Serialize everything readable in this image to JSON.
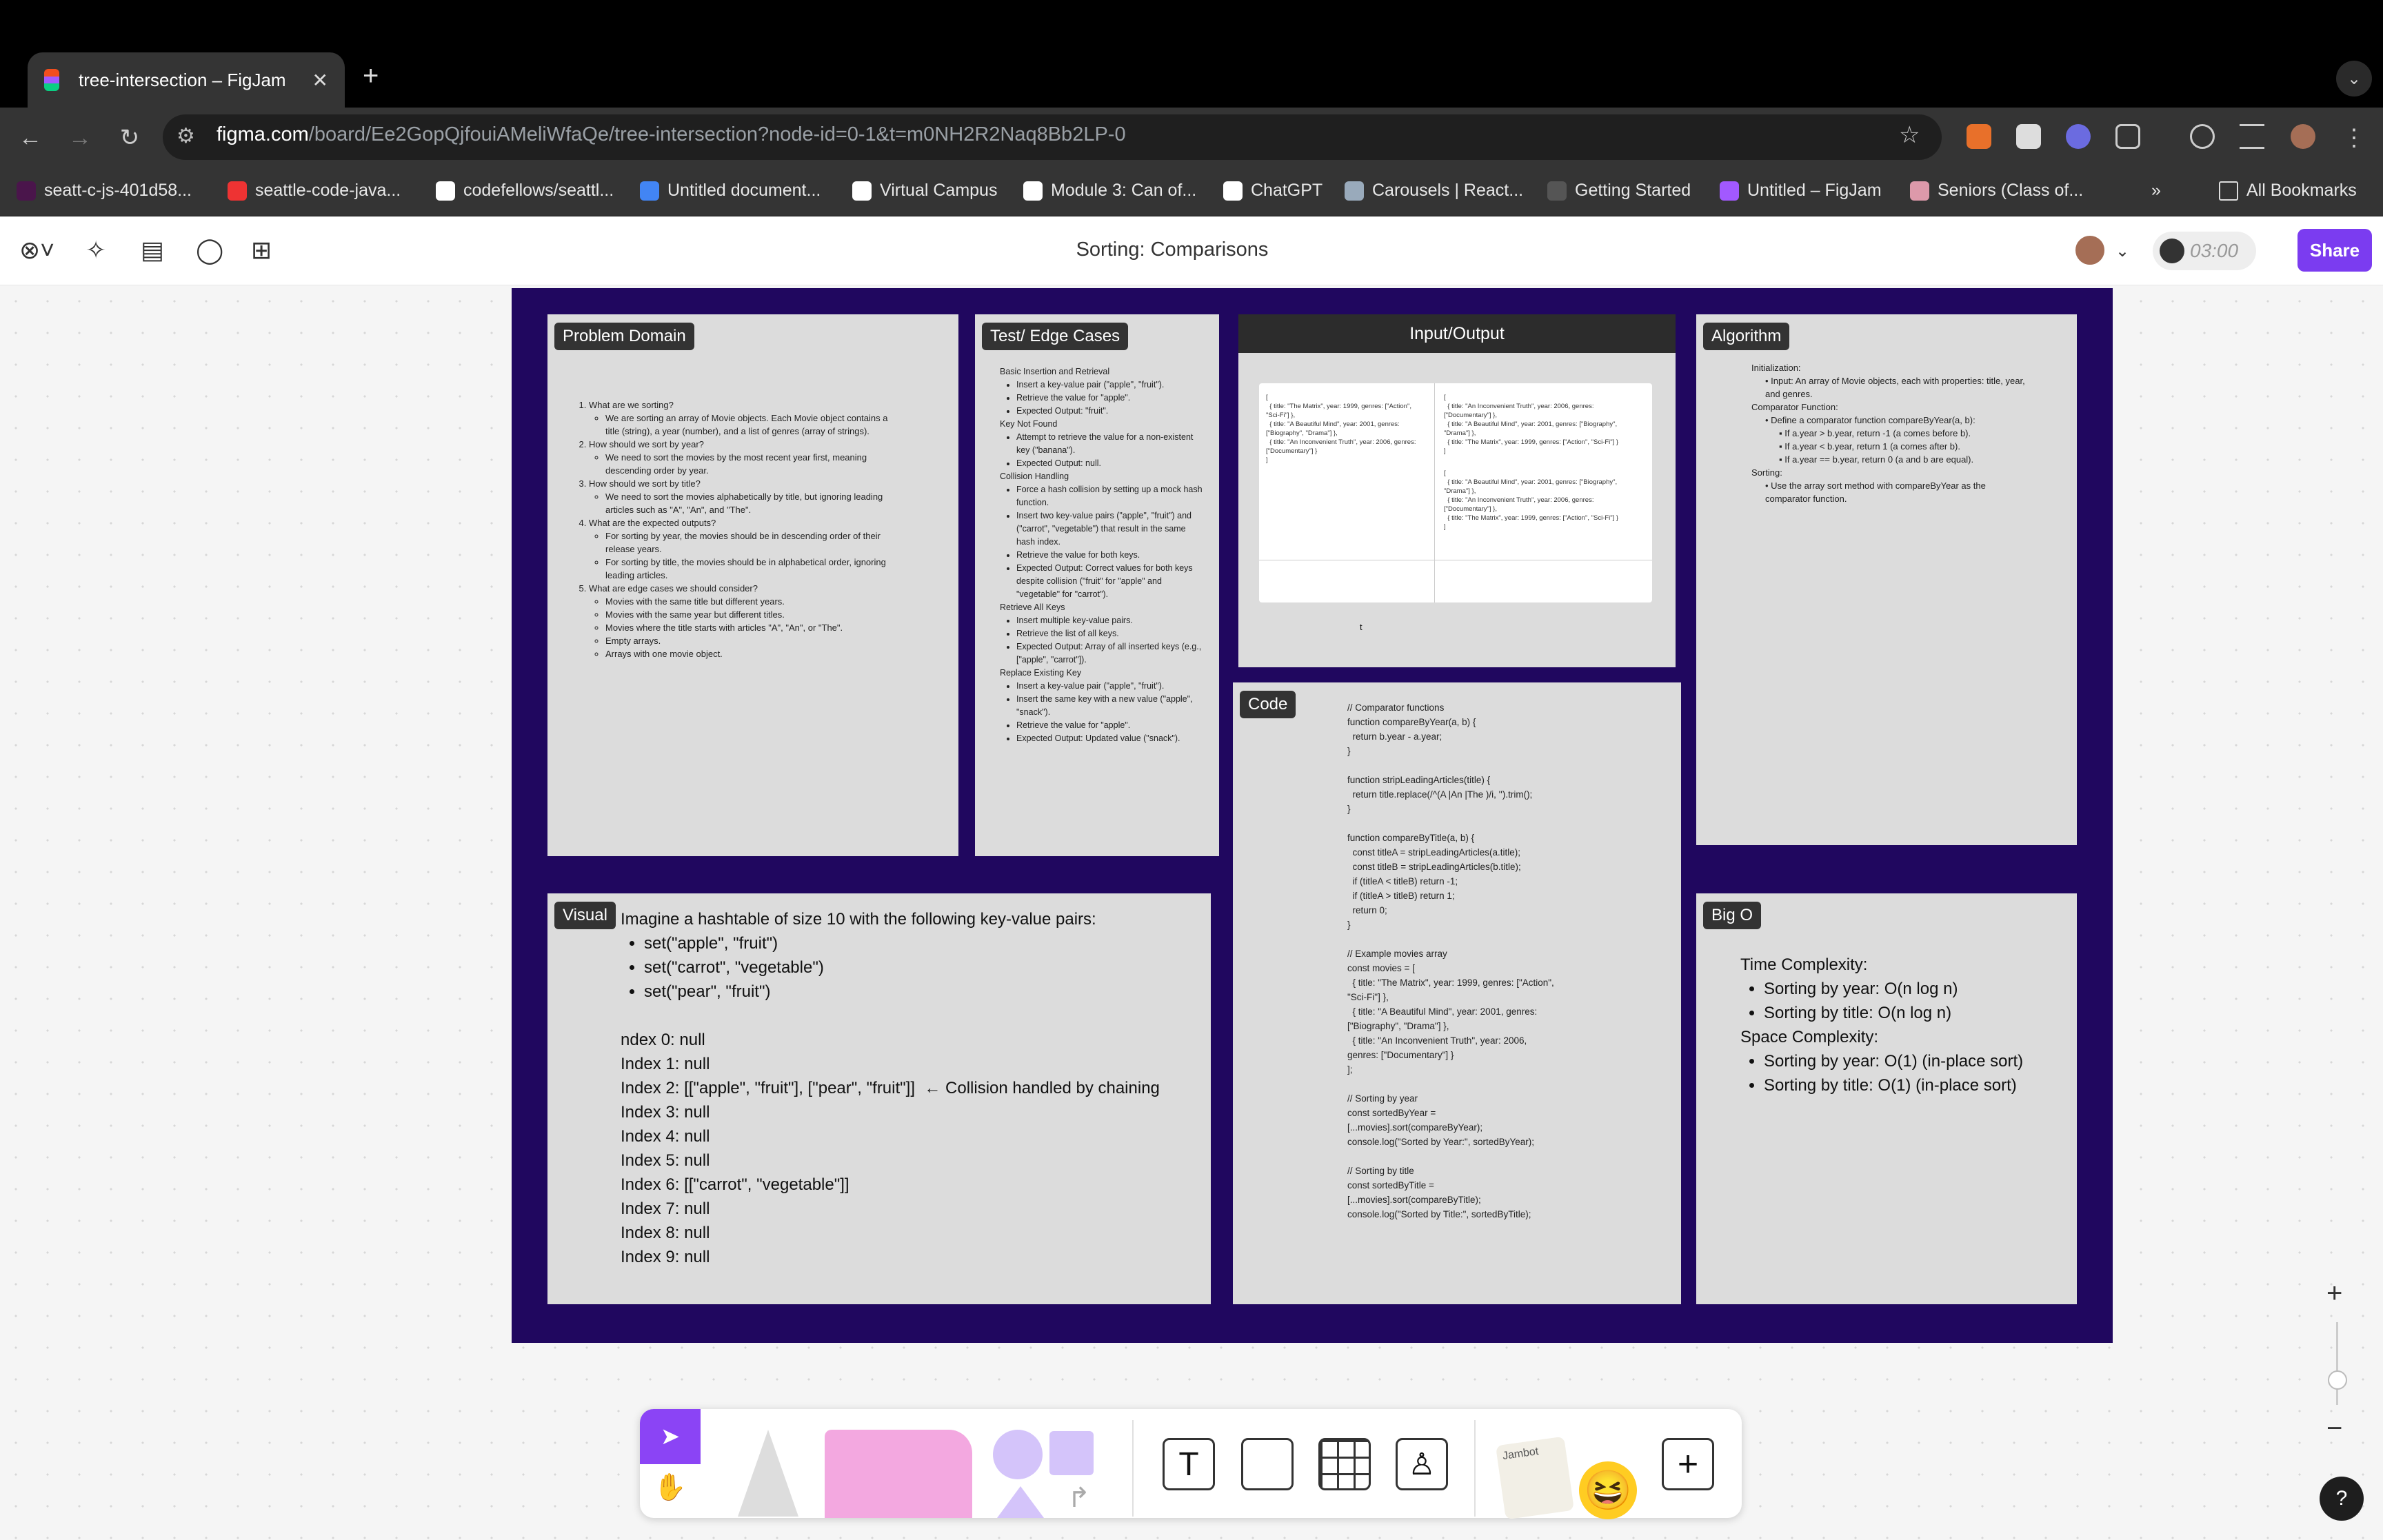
{
  "browser": {
    "tab_title": "tree-intersection – FigJam",
    "tab_close": "✕",
    "new_tab": "+",
    "url_host": "figma.com",
    "url_path": "/board/Ee2GopQjfouiAMeliWfaQe/tree-intersection?node-id=0-1&t=m0NH2R2Naq8Bb2LP-0",
    "bookmarks": [
      {
        "label": "seatt-c-js-401d58...",
        "icon": "slack-icon"
      },
      {
        "label": "seattle-code-java...",
        "icon": "record-icon"
      },
      {
        "label": "codefellows/seattl...",
        "icon": "github-icon"
      },
      {
        "label": "Untitled document...",
        "icon": "docs-icon"
      },
      {
        "label": "Virtual Campus",
        "icon": "globe-icon"
      },
      {
        "label": "Module 3: Can of...",
        "icon": "book-icon"
      },
      {
        "label": "ChatGPT",
        "icon": "chatgpt-icon"
      },
      {
        "label": "Carousels | React...",
        "icon": "react-icon"
      },
      {
        "label": "Getting Started",
        "icon": "shield-icon"
      },
      {
        "label": "Untitled – FigJam",
        "icon": "figma-icon"
      },
      {
        "label": "Seniors (Class of...",
        "icon": "person-icon"
      }
    ],
    "more": "»",
    "all_bookmarks": "All Bookmarks"
  },
  "figma": {
    "title": "Sorting: Comparisons",
    "timer": "03:00",
    "share": "Share"
  },
  "board": {
    "problem_domain": {
      "label": "Problem Domain",
      "items": [
        {
          "q": "What are we sorting?",
          "a": [
            "We are sorting an array of Movie objects. Each Movie object contains a title (string), a year (number), and a list of genres (array of strings)."
          ]
        },
        {
          "q": "How should we sort by year?",
          "a": [
            "We need to sort the movies by the most recent year first, meaning descending order by year."
          ]
        },
        {
          "q": "How should we sort by title?",
          "a": [
            "We need to sort the movies alphabetically by title, but ignoring leading articles such as \"A\", \"An\", and \"The\"."
          ]
        },
        {
          "q": "What are the expected outputs?",
          "a": [
            "For sorting by year, the movies should be in descending order of their release years.",
            "For sorting by title, the movies should be in alphabetical order, ignoring leading articles."
          ]
        },
        {
          "q": "What are edge cases we should consider?",
          "a": [
            "Movies with the same title but different years.",
            "Movies with the same year but different titles.",
            "Movies where the title starts with articles \"A\", \"An\", or \"The\".",
            "Empty arrays.",
            "Arrays with one movie object."
          ]
        }
      ]
    },
    "test_cases": {
      "label": "Test/ Edge Cases",
      "groups": [
        {
          "h": "Basic Insertion and Retrieval",
          "items": [
            "Insert a key-value pair (\"apple\", \"fruit\").",
            "Retrieve the value for \"apple\".",
            "Expected Output: \"fruit\"."
          ]
        },
        {
          "h": "Key Not Found",
          "items": [
            "Attempt to retrieve the value for a non-existent key (\"banana\").",
            "Expected Output: null."
          ]
        },
        {
          "h": "Collision Handling",
          "items": [
            "Force a hash collision by setting up a mock hash function.",
            "Insert two key-value pairs (\"apple\", \"fruit\") and (\"carrot\", \"vegetable\") that result in the same hash index.",
            "Retrieve the value for both keys.",
            "Expected Output: Correct values for both keys despite collision (\"fruit\" for \"apple\" and \"vegetable\" for \"carrot\")."
          ]
        },
        {
          "h": "Retrieve All Keys",
          "items": [
            "Insert multiple key-value pairs.",
            "Retrieve the list of all keys.",
            "Expected Output: Array of all inserted keys (e.g., [\"apple\", \"carrot\"])."
          ]
        },
        {
          "h": "Replace Existing Key",
          "items": [
            "Insert a key-value pair (\"apple\", \"fruit\").",
            "Insert the same key with a new value (\"apple\", \"snack\").",
            "Retrieve the value for \"apple\".",
            "Expected Output: Updated value (\"snack\")."
          ]
        }
      ]
    },
    "io": {
      "label": "Input/Output",
      "input": "[\n  { title: \"The Matrix\", year: 1999, genres: [\"Action\",\n\"Sci-Fi\"] },\n  { title: \"A Beautiful Mind\", year: 2001, genres:\n[\"Biography\", \"Drama\"] },\n  { title: \"An Inconvenient Truth\", year: 2006, genres:\n[\"Documentary\"] }\n]",
      "output_year": "[\n  { title: \"An Inconvenient Truth\", year: 2006, genres:\n[\"Documentary\"] },\n  { title: \"A Beautiful Mind\", year: 2001, genres: [\"Biography\",\n\"Drama\"] },\n  { title: \"The Matrix\", year: 1999, genres: [\"Action\", \"Sci-Fi\"] }\n]",
      "output_title": "[\n  { title: \"A Beautiful Mind\", year: 2001, genres: [\"Biography\",\n\"Drama\"] },\n  { title: \"An Inconvenient Truth\", year: 2006, genres:\n[\"Documentary\"] },\n  { title: \"The Matrix\", year: 1999, genres: [\"Action\", \"Sci-Fi\"] }\n]",
      "cursor_text": "t"
    },
    "algorithm": {
      "label": "Algorithm",
      "lines": [
        {
          "lvl": 0,
          "t": "Initialization:"
        },
        {
          "lvl": 1,
          "t": "Input: An array of Movie objects, each with properties: title, year, and genres."
        },
        {
          "lvl": 0,
          "t": "Comparator Function:"
        },
        {
          "lvl": 1,
          "t": "Define a comparator function compareByYear(a, b):"
        },
        {
          "lvl": 2,
          "t": "If a.year > b.year, return -1 (a comes before b)."
        },
        {
          "lvl": 2,
          "t": "If a.year < b.year, return 1 (a comes after b)."
        },
        {
          "lvl": 2,
          "t": "If a.year == b.year, return 0 (a and b are equal)."
        },
        {
          "lvl": 0,
          "t": "Sorting:"
        },
        {
          "lvl": 1,
          "t": "Use the array sort method with compareByYear as the comparator function."
        }
      ]
    },
    "code": {
      "label": "Code",
      "text": "// Comparator functions\nfunction compareByYear(a, b) {\n  return b.year - a.year;\n}\n\nfunction stripLeadingArticles(title) {\n  return title.replace(/^(A |An |The )/i, '').trim();\n}\n\nfunction compareByTitle(a, b) {\n  const titleA = stripLeadingArticles(a.title);\n  const titleB = stripLeadingArticles(b.title);\n  if (titleA < titleB) return -1;\n  if (titleA > titleB) return 1;\n  return 0;\n}\n\n// Example movies array\nconst movies = [\n  { title: \"The Matrix\", year: 1999, genres: [\"Action\",\n\"Sci-Fi\"] },\n  { title: \"A Beautiful Mind\", year: 2001, genres:\n[\"Biography\", \"Drama\"] },\n  { title: \"An Inconvenient Truth\", year: 2006,\ngenres: [\"Documentary\"] }\n];\n\n// Sorting by year\nconst sortedByYear =\n[...movies].sort(compareByYear);\nconsole.log(\"Sorted by Year:\", sortedByYear);\n\n// Sorting by title\nconst sortedByTitle =\n[...movies].sort(compareByTitle);\nconsole.log(\"Sorted by Title:\", sortedByTitle);"
    },
    "visual": {
      "label": "Visual",
      "intro": "Imagine a hashtable of size 10 with the following key-value pairs:",
      "sets": [
        "set(\"apple\", \"fruit\")",
        "set(\"carrot\", \"vegetable\")",
        "set(\"pear\", \"fruit\")"
      ],
      "indexes": [
        "ndex 0: null",
        "Index 1: null",
        "Index 2: [[\"apple\", \"fruit\"], [\"pear\", \"fruit\"]]  ← Collision handled by chaining",
        "Index 3: null",
        "Index 4: null",
        "Index 5: null",
        "Index 6: [[\"carrot\", \"vegetable\"]]",
        "Index 7: null",
        "Index 8: null",
        "Index 9: null"
      ]
    },
    "bigo": {
      "label": "Big O",
      "time_h": "Time Complexity:",
      "time": [
        "Sorting by year: O(n log n)",
        "Sorting by title: O(n log n)"
      ],
      "space_h": "Space Complexity:",
      "space": [
        "Sorting by year: O(1) (in-place sort)",
        "Sorting by title: O(1) (in-place sort)"
      ]
    }
  },
  "bottom_toolbar": {
    "sticker_label": "Jambot"
  },
  "zoom": {
    "plus": "+",
    "minus": "−"
  },
  "help": "?",
  "colors": {
    "section": "#20075f",
    "accent": "#7b3cf0",
    "sticky": "#dcdcdc"
  }
}
